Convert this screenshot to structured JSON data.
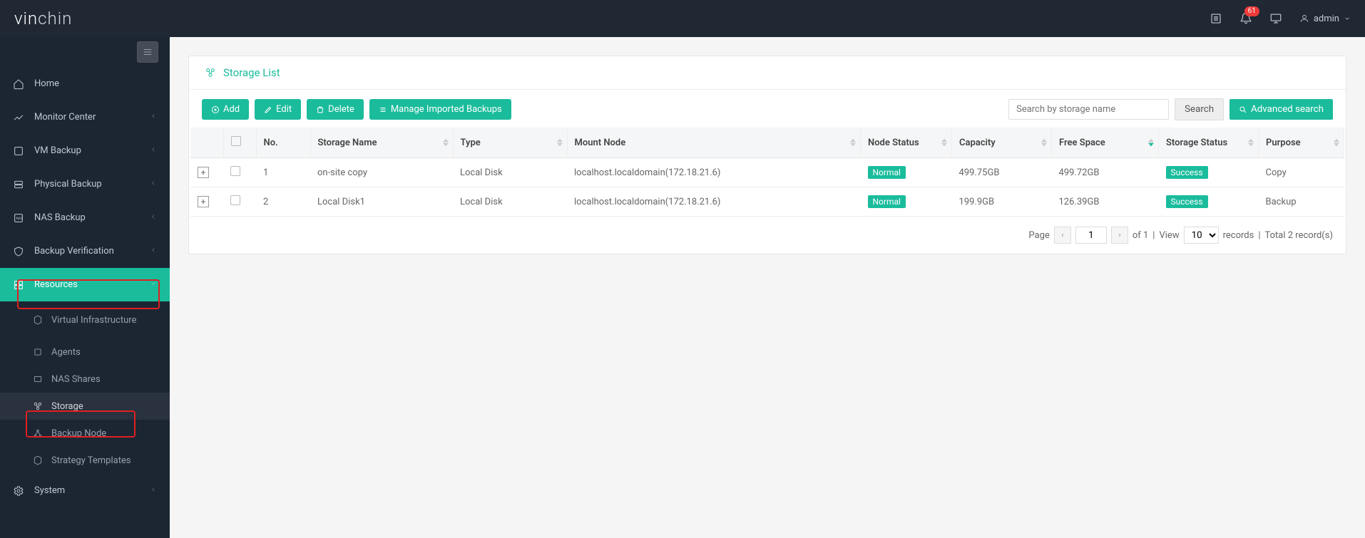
{
  "brand": {
    "part1": "vin",
    "part2": "chin"
  },
  "topbar": {
    "badge": "61",
    "user": "admin"
  },
  "sidebar": {
    "items": [
      {
        "label": "Home"
      },
      {
        "label": "Monitor Center"
      },
      {
        "label": "VM Backup"
      },
      {
        "label": "Physical Backup"
      },
      {
        "label": "NAS Backup"
      },
      {
        "label": "Backup Verification"
      },
      {
        "label": "Resources"
      },
      {
        "label": "System"
      }
    ],
    "resources_children": [
      {
        "label": "Virtual Infrastructure"
      },
      {
        "label": "Agents"
      },
      {
        "label": "NAS Shares"
      },
      {
        "label": "Storage"
      },
      {
        "label": "Backup Node"
      },
      {
        "label": "Strategy Templates"
      }
    ]
  },
  "panel": {
    "title": "Storage List"
  },
  "toolbar": {
    "add": "Add",
    "edit": "Edit",
    "delete": "Delete",
    "manage": "Manage Imported Backups",
    "search_placeholder": "Search by storage name",
    "search_btn": "Search",
    "advanced": "Advanced search"
  },
  "table": {
    "headers": {
      "no": "No.",
      "name": "Storage Name",
      "type": "Type",
      "mount": "Mount Node",
      "node_status": "Node Status",
      "capacity": "Capacity",
      "free": "Free Space",
      "storage_status": "Storage Status",
      "purpose": "Purpose"
    },
    "rows": [
      {
        "no": "1",
        "name": "on-site copy",
        "type": "Local Disk",
        "mount": "localhost.localdomain(172.18.21.6)",
        "node_status": "Normal",
        "capacity": "499.75GB",
        "free": "499.72GB",
        "storage_status": "Success",
        "purpose": "Copy"
      },
      {
        "no": "2",
        "name": "Local Disk1",
        "type": "Local Disk",
        "mount": "localhost.localdomain(172.18.21.6)",
        "node_status": "Normal",
        "capacity": "199.9GB",
        "free": "126.39GB",
        "storage_status": "Success",
        "purpose": "Backup"
      }
    ]
  },
  "pagination": {
    "page_label": "Page",
    "current": "1",
    "of_label": "of 1",
    "view_label": "View",
    "page_size": "10",
    "records_label": "records",
    "total_label": "Total 2 record(s)"
  }
}
